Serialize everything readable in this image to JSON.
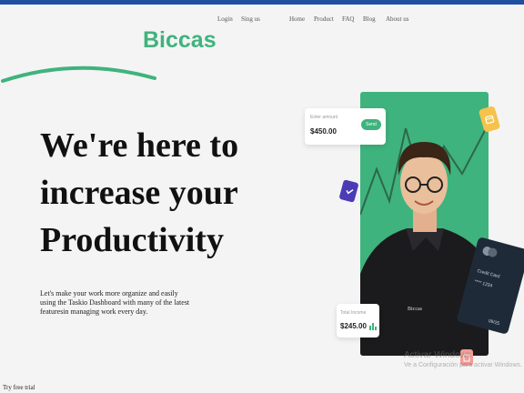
{
  "header": {
    "brand": "Biccas",
    "login": "Login",
    "signup": "Sing us",
    "nav": [
      "Home",
      "Product",
      "FAQ",
      "Blog",
      "About us"
    ]
  },
  "hero": {
    "line1": "We're here to",
    "line2": "increase your",
    "line3": "Productivity",
    "description": "Let's make your work more organize and easily using the Taskio Dashboard with many of the latest featuresin managing work every day.",
    "trial": "Try free trial"
  },
  "amount_card": {
    "label": "Enter amount",
    "value": "$450.00",
    "button": "Send"
  },
  "income_card": {
    "label": "Total Income",
    "value": "$245.00"
  },
  "credit_card": {
    "name": "Credit Card",
    "number": "**** 1234",
    "expiry": "09/25"
  },
  "icons": {
    "sticky": "calendar-icon",
    "check": "check-icon",
    "bottom": "document-icon"
  },
  "watermark": {
    "title": "Activar Windows",
    "subtitle": "Ve a Configuración para activar Windows."
  },
  "colors": {
    "brand": "#3fb37d",
    "topbar": "#1f4fa0",
    "purple": "#4b3bb5",
    "yellow": "#f5c24c"
  }
}
